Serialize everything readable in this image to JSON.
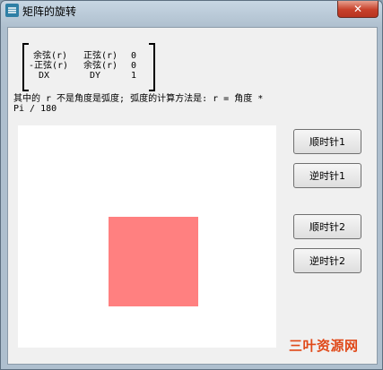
{
  "window": {
    "title": "矩阵的旋转",
    "close_symbol": "✕"
  },
  "matrix": {
    "rows": [
      [
        "余弦(r)",
        "正弦(r)",
        "0"
      ],
      [
        "-正弦(r)",
        "余弦(r)",
        "0"
      ],
      [
        "DX",
        "DY",
        "1"
      ]
    ]
  },
  "note": {
    "line1": "其中的  r  不是角度是弧度;  弧度的计算方法是:  r  =  角度  *",
    "line2": "Pi  /  180"
  },
  "shape": {
    "color": "#ff8080"
  },
  "buttons": {
    "cw1": "顺时针1",
    "ccw1": "逆时针1",
    "cw2": "顺时针2",
    "ccw2": "逆时针2"
  },
  "watermark": "三叶资源网"
}
